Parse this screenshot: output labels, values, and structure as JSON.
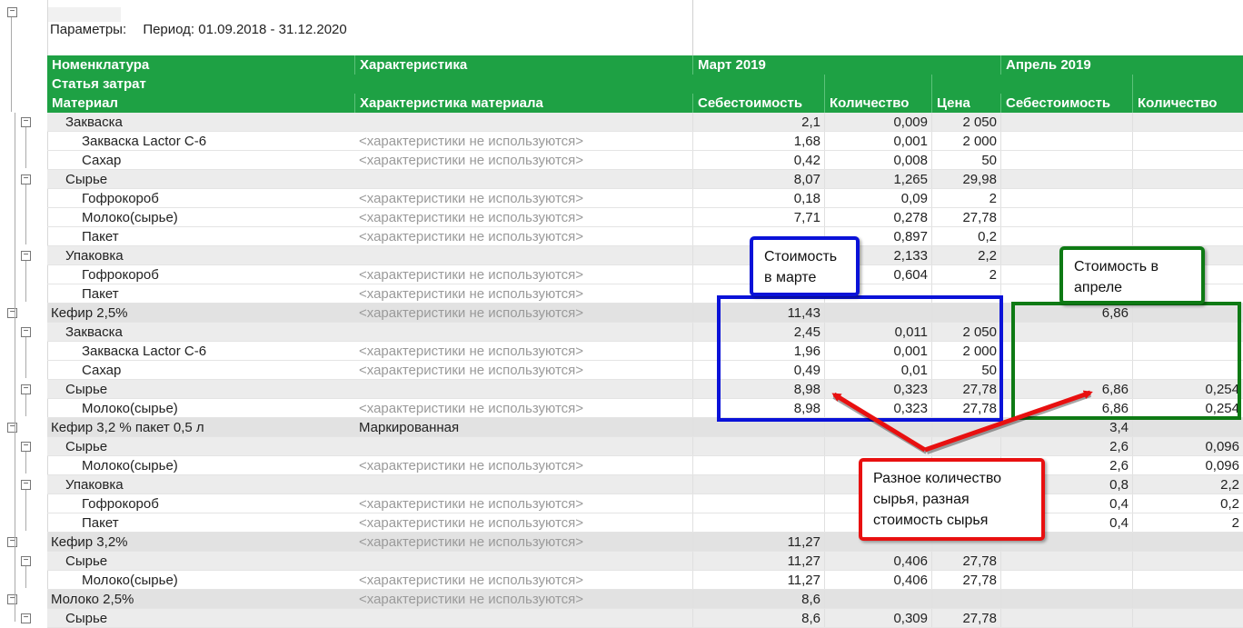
{
  "params": {
    "label": "Параметры:",
    "period": "Период: 01.09.2018 - 31.12.2020"
  },
  "header": {
    "nomenclature": "Номенклатура",
    "characteristic": "Характеристика",
    "cost_item": "Статья затрат",
    "material": "Материал",
    "material_characteristic": "Характеристика материала",
    "month1": "Март 2019",
    "month2": "Апрель 2019",
    "cost": "Себестоимость",
    "qty": "Количество",
    "price": "Цена",
    "cost2": "Себестоимость",
    "qty2": "Количество"
  },
  "rows": [
    {
      "level": 1,
      "name": "Закваска",
      "char": "",
      "m_cost": "2,1",
      "m_qty": "0,009",
      "m_price": "2 050",
      "a_cost": "",
      "a_qty": ""
    },
    {
      "level": 2,
      "name": "Закваска Lactor C-6",
      "char": "<характеристики не используются>",
      "m_cost": "1,68",
      "m_qty": "0,001",
      "m_price": "2 000",
      "a_cost": "",
      "a_qty": ""
    },
    {
      "level": 2,
      "name": "Сахар",
      "char": "<характеристики не используются>",
      "m_cost": "0,42",
      "m_qty": "0,008",
      "m_price": "50",
      "a_cost": "",
      "a_qty": ""
    },
    {
      "level": 1,
      "name": "Сырье",
      "char": "",
      "m_cost": "8,07",
      "m_qty": "1,265",
      "m_price": "29,98",
      "a_cost": "",
      "a_qty": ""
    },
    {
      "level": 2,
      "name": "Гофрокороб",
      "char": "<характеристики не используются>",
      "m_cost": "0,18",
      "m_qty": "0,09",
      "m_price": "2",
      "a_cost": "",
      "a_qty": ""
    },
    {
      "level": 2,
      "name": "Молоко(сырье)",
      "char": "<характеристики не используются>",
      "m_cost": "7,71",
      "m_qty": "0,278",
      "m_price": "27,78",
      "a_cost": "",
      "a_qty": ""
    },
    {
      "level": 2,
      "name": "Пакет",
      "char": "<характеристики не используются>",
      "m_cost": "",
      "m_qty": "0,897",
      "m_price": "0,2",
      "a_cost": "",
      "a_qty": ""
    },
    {
      "level": 1,
      "name": "Упаковка",
      "char": "",
      "m_cost": "",
      "m_qty": "2,133",
      "m_price": "2,2",
      "a_cost": "",
      "a_qty": ""
    },
    {
      "level": 2,
      "name": "Гофрокороб",
      "char": "<характеристики не используются>",
      "m_cost": "",
      "m_qty": "0,604",
      "m_price": "2",
      "a_cost": "",
      "a_qty": ""
    },
    {
      "level": 2,
      "name": "Пакет",
      "char": "<характеристики не используются>",
      "m_cost": "",
      "m_qty": "",
      "m_price": "",
      "a_cost": "",
      "a_qty": ""
    },
    {
      "level": 0,
      "name": "Кефир 2,5%",
      "char": "<характеристики не используются>",
      "m_cost": "11,43",
      "m_qty": "",
      "m_price": "",
      "a_cost": "6,86",
      "a_qty": ""
    },
    {
      "level": 1,
      "name": "Закваска",
      "char": "",
      "m_cost": "2,45",
      "m_qty": "0,011",
      "m_price": "2 050",
      "a_cost": "",
      "a_qty": ""
    },
    {
      "level": 2,
      "name": "Закваска Lactor C-6",
      "char": "<характеристики не используются>",
      "m_cost": "1,96",
      "m_qty": "0,001",
      "m_price": "2 000",
      "a_cost": "",
      "a_qty": ""
    },
    {
      "level": 2,
      "name": "Сахар",
      "char": "<характеристики не используются>",
      "m_cost": "0,49",
      "m_qty": "0,01",
      "m_price": "50",
      "a_cost": "",
      "a_qty": ""
    },
    {
      "level": 1,
      "name": "Сырье",
      "char": "",
      "m_cost": "8,98",
      "m_qty": "0,323",
      "m_price": "27,78",
      "a_cost": "6,86",
      "a_qty": "0,254"
    },
    {
      "level": 2,
      "name": "Молоко(сырье)",
      "char": "<характеристики не используются>",
      "m_cost": "8,98",
      "m_qty": "0,323",
      "m_price": "27,78",
      "a_cost": "6,86",
      "a_qty": "0,254"
    },
    {
      "level": 0,
      "name": "Кефир 3,2 % пакет 0,5 л",
      "char": "Маркированная",
      "char_plain": true,
      "m_cost": "",
      "m_qty": "",
      "m_price": "",
      "a_cost": "3,4",
      "a_qty": ""
    },
    {
      "level": 1,
      "name": "Сырье",
      "char": "",
      "m_cost": "",
      "m_qty": "",
      "m_price": "",
      "a_cost": "2,6",
      "a_qty": "0,096"
    },
    {
      "level": 2,
      "name": "Молоко(сырье)",
      "char": "<характеристики не используются>",
      "m_cost": "",
      "m_qty": "",
      "m_price": "",
      "a_cost": "2,6",
      "a_qty": "0,096"
    },
    {
      "level": 1,
      "name": "Упаковка",
      "char": "",
      "m_cost": "",
      "m_qty": "",
      "m_price": "",
      "a_cost": "0,8",
      "a_qty": "2,2"
    },
    {
      "level": 2,
      "name": "Гофрокороб",
      "char": "<характеристики не используются>",
      "m_cost": "",
      "m_qty": "",
      "m_price": "",
      "a_cost": "0,4",
      "a_qty": "0,2"
    },
    {
      "level": 2,
      "name": "Пакет",
      "char": "<характеристики не используются>",
      "m_cost": "",
      "m_qty": "",
      "m_price": "",
      "a_cost": "0,4",
      "a_qty": "2"
    },
    {
      "level": 0,
      "name": "Кефир 3,2%",
      "char": "<характеристики не используются>",
      "m_cost": "11,27",
      "m_qty": "",
      "m_price": "",
      "a_cost": "",
      "a_qty": ""
    },
    {
      "level": 1,
      "name": "Сырье",
      "char": "",
      "m_cost": "11,27",
      "m_qty": "0,406",
      "m_price": "27,78",
      "a_cost": "",
      "a_qty": ""
    },
    {
      "level": 2,
      "name": "Молоко(сырье)",
      "char": "<характеристики не используются>",
      "m_cost": "11,27",
      "m_qty": "0,406",
      "m_price": "27,78",
      "a_cost": "",
      "a_qty": ""
    },
    {
      "level": 0,
      "name": "Молоко 2,5%",
      "char": "<характеристики не используются>",
      "m_cost": "8,6",
      "m_qty": "",
      "m_price": "",
      "a_cost": "",
      "a_qty": ""
    },
    {
      "level": 1,
      "name": "Сырье",
      "char": "",
      "m_cost": "8,6",
      "m_qty": "0,309",
      "m_price": "27,78",
      "a_cost": "",
      "a_qty": ""
    }
  ],
  "callouts": {
    "march": "Стоимость в марте",
    "april": "Стоимость в апреле",
    "diff": "Разное количество сырья, разная стоимость сырья"
  },
  "colors": {
    "header": "#1ea144",
    "blue": "#0a12d8",
    "green": "#0e7a14",
    "red": "#e81010"
  }
}
